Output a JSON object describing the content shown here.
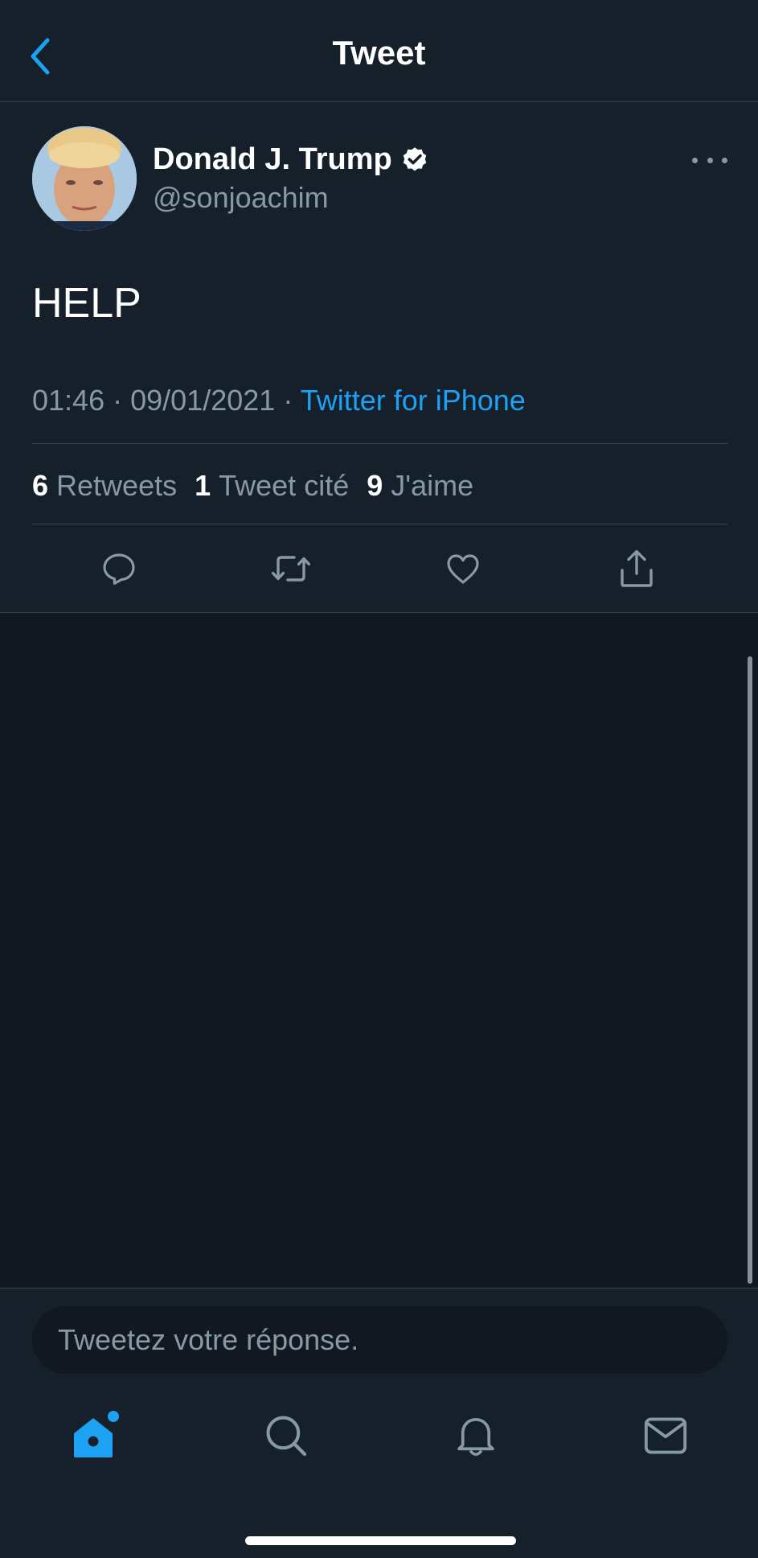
{
  "header": {
    "title": "Tweet",
    "back_icon": "chevron-left-icon"
  },
  "tweet": {
    "author": {
      "display_name": "Donald J. Trump",
      "verified": true,
      "handle": "@sonjoachim"
    },
    "text": "HELP",
    "time": "01:46",
    "date": "09/01/2021",
    "separator": "·",
    "source": "Twitter for iPhone",
    "stats": {
      "retweets_count": "6",
      "retweets_label": "Retweets",
      "quotes_count": "1",
      "quotes_label": "Tweet cité",
      "likes_count": "9",
      "likes_label": "J'aime"
    },
    "actions": [
      "reply-icon",
      "retweet-icon",
      "like-icon",
      "share-icon"
    ]
  },
  "reply": {
    "placeholder": "Tweetez votre réponse."
  },
  "tabbar": {
    "items": [
      "home-icon",
      "search-icon",
      "notifications-icon",
      "messages-icon"
    ],
    "active": "home-icon"
  },
  "colors": {
    "background": "#15202b",
    "background_dark": "#111821",
    "accent": "#1da1f2",
    "secondary_text": "#8899a6",
    "border": "#38444d"
  }
}
